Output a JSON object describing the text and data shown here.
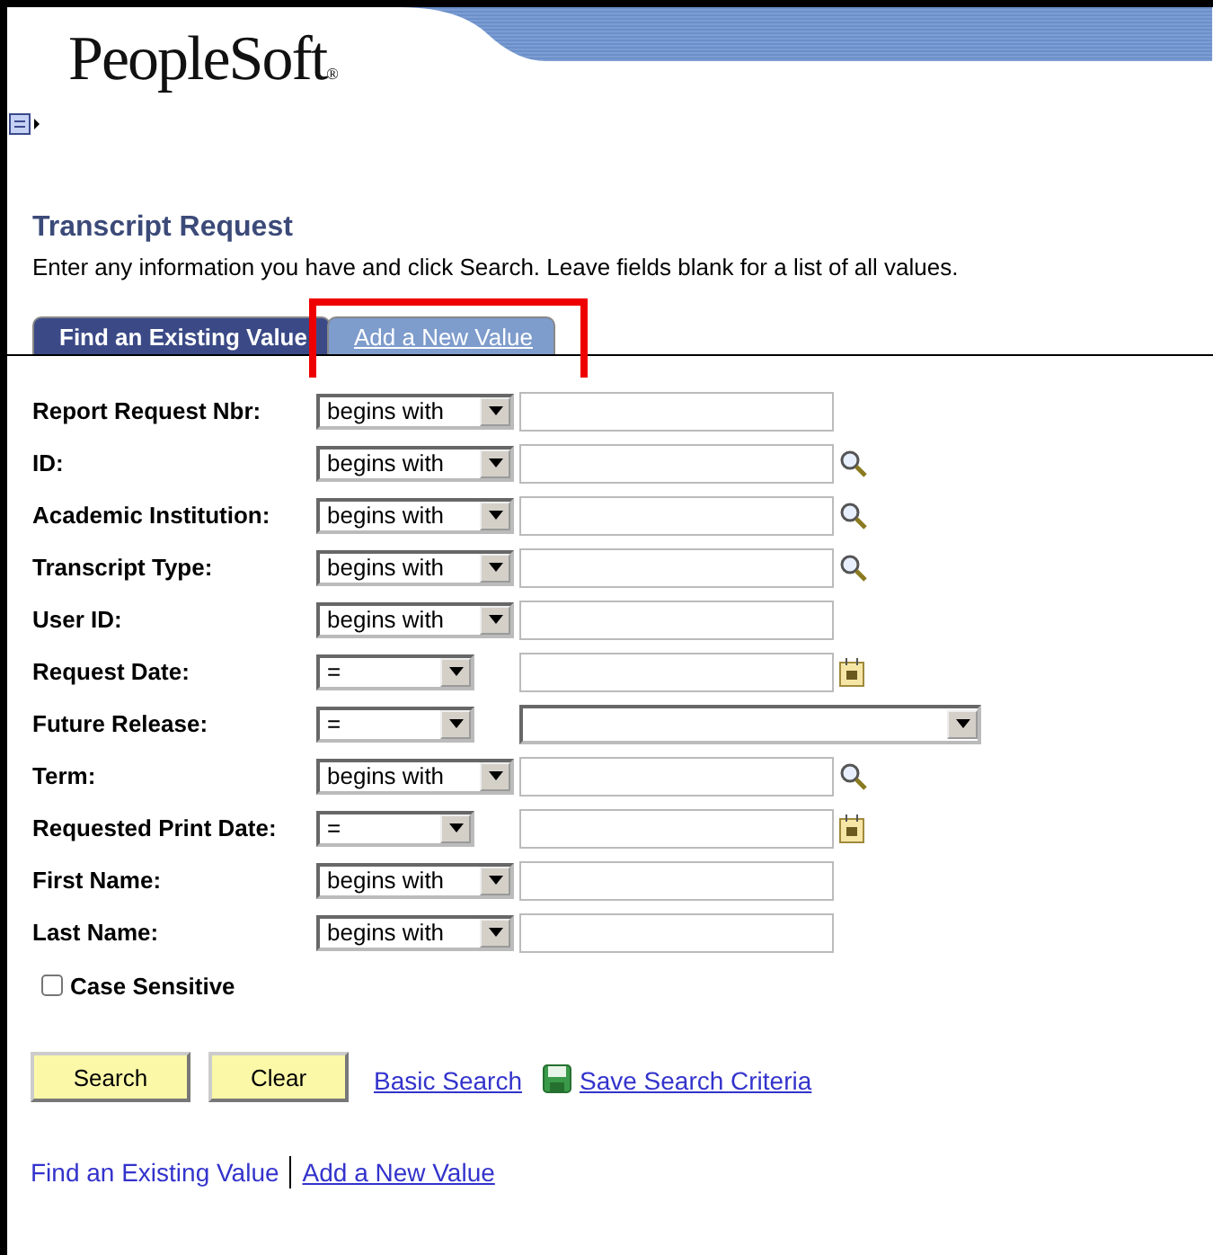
{
  "header": {
    "logo": "PeopleSoft",
    "logo_mark": "®"
  },
  "page": {
    "title": "Transcript Request",
    "instructions": "Enter any information you have and click Search. Leave fields blank for a list of all values."
  },
  "tabs": [
    {
      "label": "Find an Existing Value",
      "selected": true,
      "highlighted": false
    },
    {
      "label": "Add a New Value",
      "selected": false,
      "highlighted": true
    }
  ],
  "fields": [
    {
      "label": "Report Request Nbr:",
      "operator": "begins with",
      "kind": "text"
    },
    {
      "label": "ID:",
      "operator": "begins with",
      "kind": "lookup"
    },
    {
      "label": "Academic Institution:",
      "operator": "begins with",
      "kind": "lookup"
    },
    {
      "label": "Transcript Type:",
      "operator": "begins with",
      "kind": "lookup"
    },
    {
      "label": "User ID:",
      "operator": "begins with",
      "kind": "text"
    },
    {
      "label": "Request Date:",
      "operator": "=",
      "kind": "date"
    },
    {
      "label": "Future Release:",
      "operator": "=",
      "kind": "select"
    },
    {
      "label": "Term:",
      "operator": "begins with",
      "kind": "lookup"
    },
    {
      "label": "Requested Print Date:",
      "operator": "=",
      "kind": "date"
    },
    {
      "label": "First Name:",
      "operator": "begins with",
      "kind": "text"
    },
    {
      "label": "Last Name:",
      "operator": "begins with",
      "kind": "text"
    }
  ],
  "case_sensitive": {
    "label": "Case Sensitive",
    "checked": false
  },
  "buttons": [
    "Search",
    "Clear"
  ],
  "links": [
    {
      "label": "Basic Search",
      "kind": "plain"
    },
    {
      "label": "Save Search Criteria",
      "kind": "save"
    }
  ],
  "footer_links": [
    "Find an Existing Value",
    "Add a New Value"
  ]
}
